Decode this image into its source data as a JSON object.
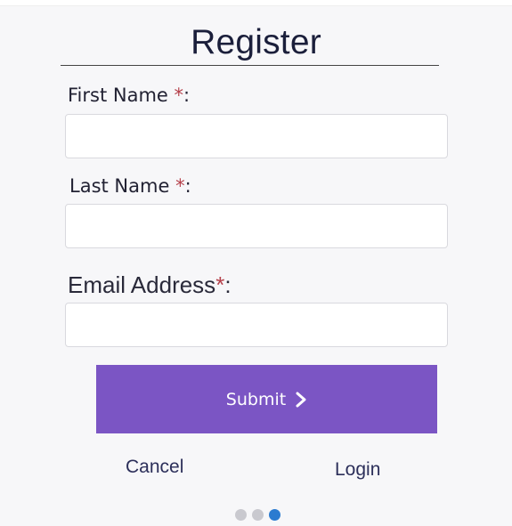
{
  "form": {
    "title": "Register",
    "fields": [
      {
        "label": "First Name ",
        "required_mark": "*",
        "suffix": ":",
        "value": ""
      },
      {
        "label": "Last Name ",
        "required_mark": "*",
        "suffix": ":",
        "value": ""
      },
      {
        "label": "Email Address",
        "required_mark": "*",
        "suffix": ":",
        "value": ""
      }
    ],
    "submit_label": "Submit",
    "submit_icon": "chevron-right-icon",
    "cancel_label": "Cancel",
    "login_label": "Login"
  },
  "pagination": {
    "count": 3,
    "active_index": 2
  },
  "colors": {
    "accent": "#7b55c4",
    "required": "#b5404a",
    "active_dot": "#2b7bd0",
    "inactive_dot": "#c9c9cf"
  }
}
